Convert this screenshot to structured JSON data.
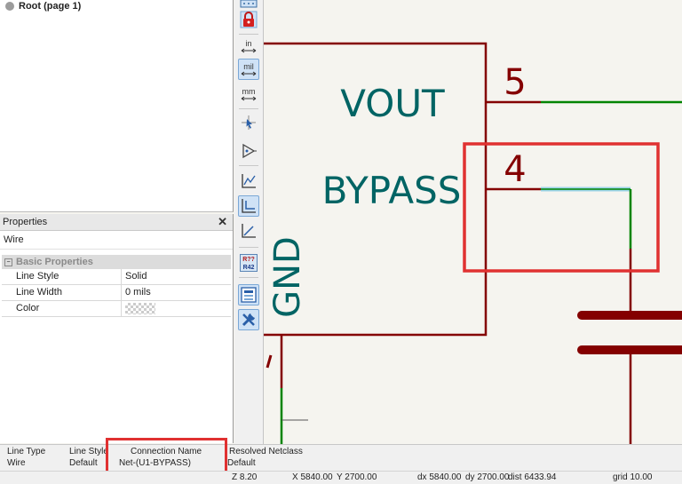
{
  "hierarchy": {
    "root_label": "Root (page 1)"
  },
  "properties": {
    "title": "Properties",
    "close_symbol": "✕",
    "item_type": "Wire",
    "section_label": "Basic Properties",
    "section_toggle": "−",
    "rows": [
      {
        "key": "Line Style",
        "value": "Solid"
      },
      {
        "key": "Line Width",
        "value": "0 mils"
      },
      {
        "key": "Color",
        "value": ""
      }
    ]
  },
  "toolbar": {
    "icons": [
      "grid-icon",
      "lock-icon",
      "units-inch-icon",
      "units-mil-icon",
      "units-mm-icon",
      "cursor-icon",
      "pin-icon",
      "line-angle-free-icon",
      "line-angle-90-icon",
      "line-angle-45-icon",
      "annotate-icon",
      "hierarchy-navigator-icon",
      "properties-tool-icon"
    ],
    "in_label": "in",
    "mil_label": "mil",
    "mm_label": "mm",
    "annotate_top": "R??",
    "annotate_bottom": "R42"
  },
  "schematic": {
    "pin_names": {
      "vout": "VOUT",
      "bypass": "BYPASS",
      "gnd": "GND"
    },
    "pin_numbers": {
      "vout": "5",
      "bypass": "4"
    },
    "colors": {
      "symbol": "#840000",
      "pin_name": "#006464",
      "wire": "#008400",
      "wire_selected": "#9cd3e8",
      "highlight": "#e03131",
      "background": "#f5f4ef"
    }
  },
  "message_panel": {
    "columns": [
      {
        "header": "Line Type",
        "value": "Wire"
      },
      {
        "header": "Line Style",
        "value": "Default"
      },
      {
        "header": "Connection Name",
        "value": "Net-(U1-BYPASS)"
      },
      {
        "header": "Resolved Netclass",
        "value": "Default"
      }
    ]
  },
  "status": {
    "zoom": "Z 8.20",
    "x": "X 5840.00",
    "y": "Y 2700.00",
    "dx": "dx 5840.00",
    "dy": "dy 2700.00",
    "dist": "dist 6433.94",
    "grid": "grid 10.00"
  }
}
